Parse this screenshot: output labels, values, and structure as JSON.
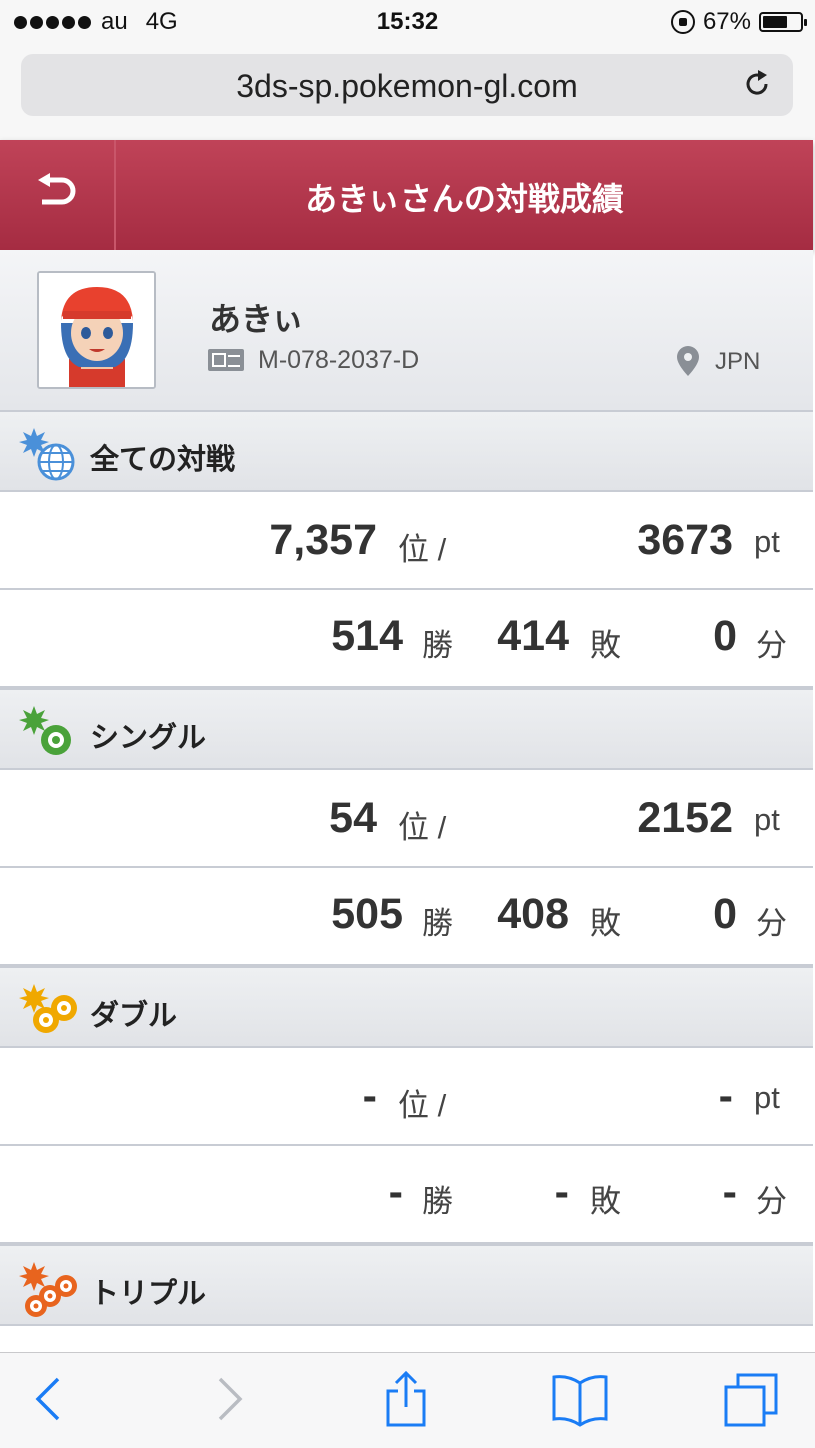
{
  "status_bar": {
    "carrier": "au",
    "network": "4G",
    "time": "15:32",
    "battery_percent": "67%",
    "battery_level": 0.67
  },
  "browser": {
    "url": "3ds-sp.pokemon-gl.com"
  },
  "header": {
    "title": "あきぃさんの対戦成績"
  },
  "profile": {
    "name": "あきぃ",
    "player_id": "M-078-2037-D",
    "region": "JPN"
  },
  "sections": {
    "all": {
      "title": "全ての対戦",
      "rank": "7,357",
      "rank_unit": "位 /",
      "points": "3673",
      "points_unit": "pt",
      "wins": "514",
      "wins_unit": "勝",
      "losses": "414",
      "losses_unit": "敗",
      "draws": "0",
      "draws_unit": "分"
    },
    "single": {
      "title": "シングル",
      "rank": "54",
      "rank_unit": "位 /",
      "points": "2152",
      "points_unit": "pt",
      "wins": "505",
      "wins_unit": "勝",
      "losses": "408",
      "losses_unit": "敗",
      "draws": "0",
      "draws_unit": "分"
    },
    "double": {
      "title": "ダブル",
      "rank": "-",
      "rank_unit": "位 /",
      "points": "-",
      "points_unit": "pt",
      "wins": "-",
      "wins_unit": "勝",
      "losses": "-",
      "losses_unit": "敗",
      "draws": "-",
      "draws_unit": "分"
    },
    "triple": {
      "title": "トリプル"
    }
  },
  "colors": {
    "header": "#b3364c",
    "all_icon": "#4a90d9",
    "single_icon": "#4aa23a",
    "double_icon": "#f0a800",
    "triple_icon": "#e8641e"
  },
  "icons": {
    "back": "back-arrow-icon",
    "reload": "reload-icon",
    "pin": "location-pin-icon",
    "id_card": "id-card-icon"
  }
}
